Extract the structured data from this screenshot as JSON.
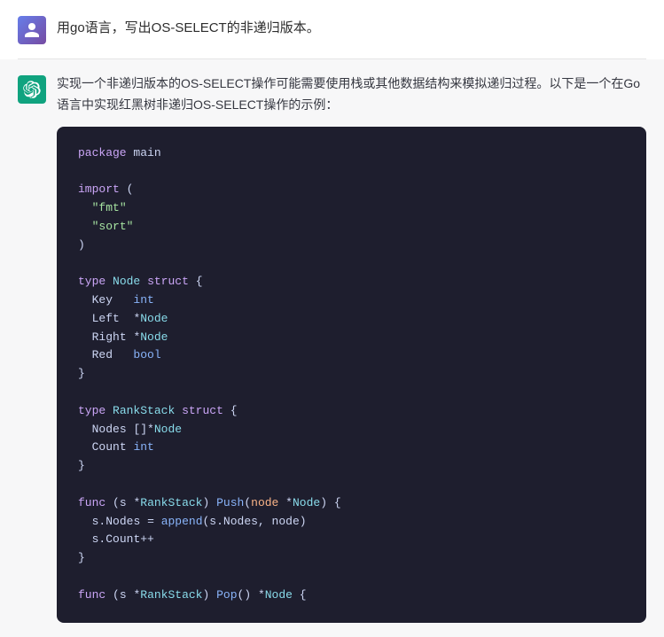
{
  "messages": [
    {
      "role": "user",
      "text": "用go语言，写出OS-SELECT的非递归版本。"
    },
    {
      "role": "assistant",
      "intro": "实现一个非递归版本的OS-SELECT操作可能需要使用栈或其他数据结构来模拟递归过程。以下是一个在Go语言中实现红黑树非递归OS-SELECT操作的示例：",
      "code": {
        "lines": [
          {
            "type": "code",
            "content": "package main"
          },
          {
            "type": "blank"
          },
          {
            "type": "code",
            "content": "import ("
          },
          {
            "type": "code",
            "content": "  \"fmt\""
          },
          {
            "type": "code",
            "content": "  \"sort\""
          },
          {
            "type": "code",
            "content": ")"
          },
          {
            "type": "blank"
          },
          {
            "type": "code",
            "content": "type Node struct {"
          },
          {
            "type": "code",
            "content": "  Key   int"
          },
          {
            "type": "code",
            "content": "  Left  *Node"
          },
          {
            "type": "code",
            "content": "  Right *Node"
          },
          {
            "type": "code",
            "content": "  Red   bool"
          },
          {
            "type": "code",
            "content": "}"
          },
          {
            "type": "blank"
          },
          {
            "type": "code",
            "content": "type RankStack struct {"
          },
          {
            "type": "code",
            "content": "  Nodes []*Node"
          },
          {
            "type": "code",
            "content": "  Count int"
          },
          {
            "type": "code",
            "content": "}"
          },
          {
            "type": "blank"
          },
          {
            "type": "code",
            "content": "func (s *RankStack) Push(node *Node) {"
          },
          {
            "type": "code",
            "content": "  s.Nodes = append(s.Nodes, node)"
          },
          {
            "type": "code",
            "content": "  s.Count++"
          },
          {
            "type": "code",
            "content": "}"
          },
          {
            "type": "blank"
          },
          {
            "type": "code",
            "content": "func (s *RankStack) Pop() *Node {"
          }
        ]
      }
    }
  ],
  "icons": {
    "user": "person",
    "assistant": "sparkle"
  }
}
